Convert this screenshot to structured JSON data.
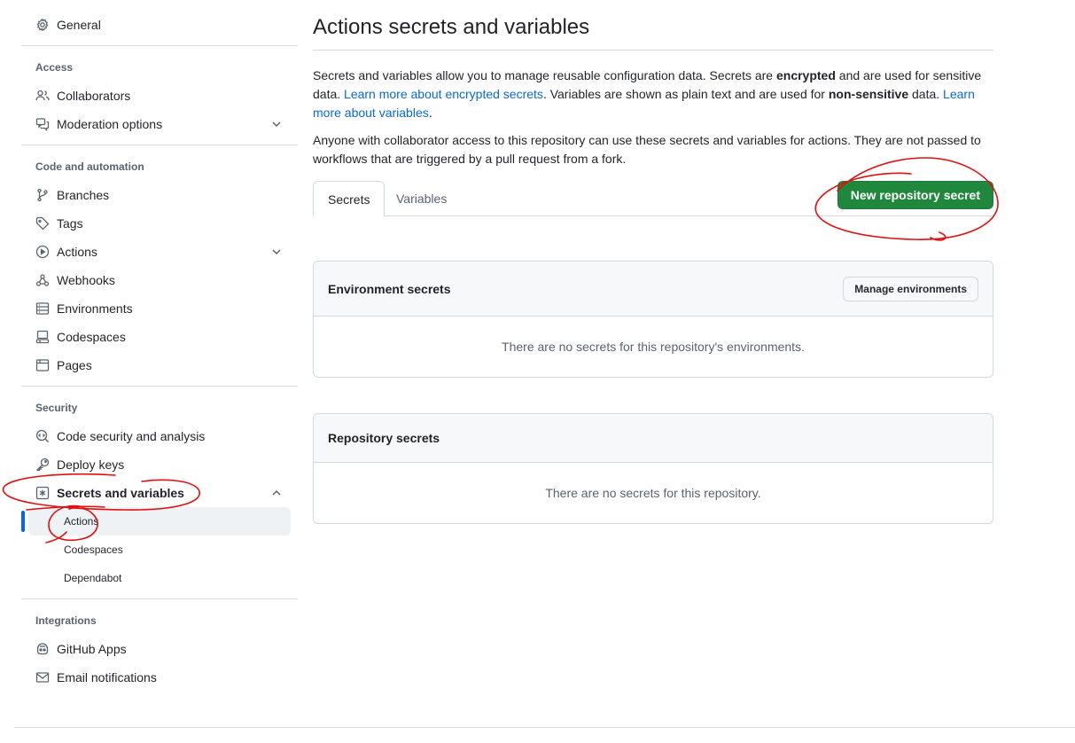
{
  "sidebar": {
    "general": "General",
    "access_heading": "Access",
    "collaborators": "Collaborators",
    "moderation": "Moderation options",
    "code_heading": "Code and automation",
    "branches": "Branches",
    "tags": "Tags",
    "actions": "Actions",
    "webhooks": "Webhooks",
    "environments": "Environments",
    "codespaces": "Codespaces",
    "pages": "Pages",
    "security_heading": "Security",
    "code_security": "Code security and analysis",
    "deploy_keys": "Deploy keys",
    "secrets_variables": "Secrets and variables",
    "sub_actions": "Actions",
    "sub_codespaces": "Codespaces",
    "sub_dependabot": "Dependabot",
    "integrations_heading": "Integrations",
    "github_apps": "GitHub Apps",
    "email_notifications": "Email notifications"
  },
  "main": {
    "title": "Actions secrets and variables",
    "desc": {
      "p1": "Secrets and variables allow you to manage reusable configuration data. Secrets are ",
      "b1": "encrypted",
      "p2": " and are used for sensitive data. ",
      "link1": "Learn more about encrypted secrets",
      "p3": ". Variables are shown as plain text and are used for ",
      "b2": "non-sensitive",
      "p4": " data. ",
      "link2": "Learn more about variables",
      "p5": "."
    },
    "desc2": "Anyone with collaborator access to this repository can use these secrets and variables for actions. They are not passed to workflows that are triggered by a pull request from a fork.",
    "tabs": [
      {
        "label": "Secrets"
      },
      {
        "label": "Variables"
      }
    ],
    "new_secret_button": "New repository secret",
    "env_box": {
      "title": "Environment secrets",
      "button": "Manage environments",
      "empty": "There are no secrets for this repository's environments."
    },
    "repo_box": {
      "title": "Repository secrets",
      "empty": "There are no secrets for this repository."
    }
  },
  "colors": {
    "primary_green": "#1f883d",
    "link_blue": "#0969da",
    "annotation_red": "#e01010"
  }
}
